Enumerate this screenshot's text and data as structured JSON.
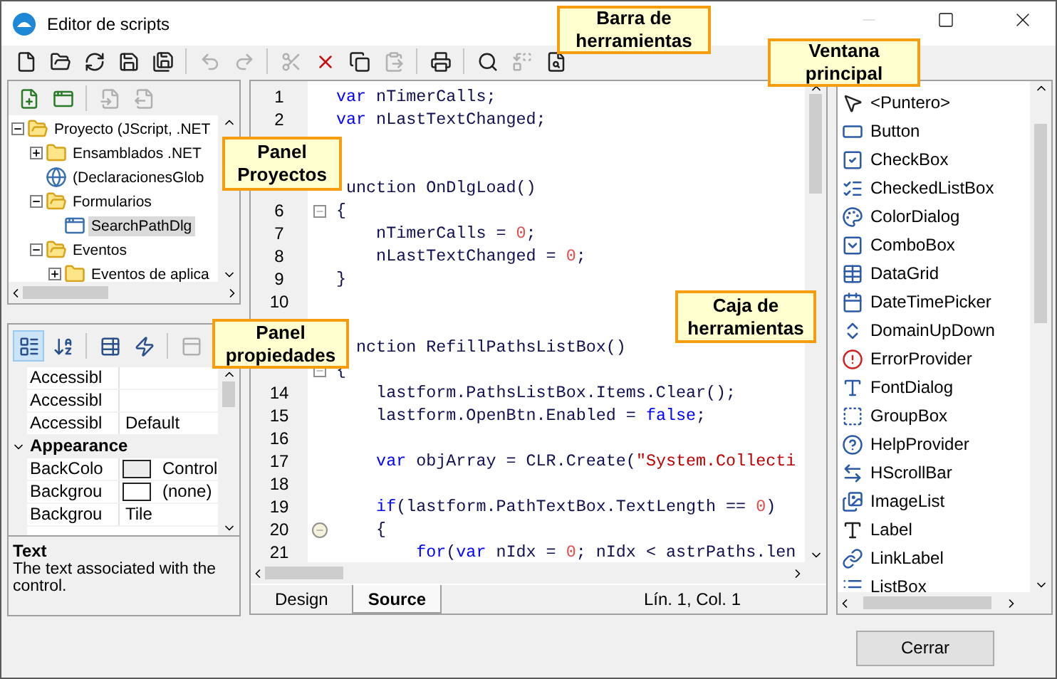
{
  "window": {
    "title": "Editor de scripts",
    "minimize_disabled": true
  },
  "main_toolbar": [
    {
      "disabled": false
    },
    {
      "disabled": false
    },
    {
      "disabled": false
    },
    {
      "disabled": false
    },
    {
      "disabled": false
    },
    {
      "disabled": true
    },
    {
      "disabled": true
    },
    {
      "disabled": true
    },
    {
      "disabled": false
    },
    {
      "disabled": false
    },
    {
      "disabled": true
    },
    {
      "disabled": false
    },
    {
      "disabled": false
    },
    {
      "disabled": true
    },
    {
      "disabled": false
    }
  ],
  "project_toolbar": [
    {
      "disabled": false
    },
    {
      "disabled": false
    },
    {
      "disabled": true
    },
    {
      "disabled": true
    }
  ],
  "tree": [
    {
      "kind": "folder",
      "label": "Proyecto (JScript, .NET",
      "expanded": true,
      "selected": false,
      "children": [
        {
          "kind": "folder",
          "label": "Ensamblados .NET",
          "expanded": false,
          "selected": false
        },
        {
          "kind": "globals",
          "label": "(DeclaracionesGlob",
          "selected": false
        },
        {
          "kind": "folder",
          "label": "Formularios",
          "expanded": true,
          "selected": false,
          "children": [
            {
              "kind": "form",
              "label": "SearchPathDlg",
              "selected": true
            }
          ]
        },
        {
          "kind": "folder",
          "label": "Eventos",
          "expanded": true,
          "selected": false,
          "children": [
            {
              "kind": "folder",
              "label": "Eventos de aplica",
              "expanded": false,
              "selected": false
            }
          ]
        }
      ]
    }
  ],
  "properties_toolbar": [
    {
      "selected": true,
      "disabled": false
    },
    {
      "selected": false,
      "disabled": false
    },
    {
      "selected": false,
      "disabled": false
    },
    {
      "selected": false,
      "disabled": false
    },
    {
      "selected": false,
      "disabled": true
    }
  ],
  "properties": [
    {
      "kind": "property",
      "name": "Accessibl"
    },
    {
      "kind": "property",
      "name": "Accessibl"
    },
    {
      "kind": "property",
      "name": "Accessibl",
      "value": "Default"
    },
    {
      "kind": "category",
      "name": "Appearance",
      "expanded": true
    },
    {
      "kind": "property",
      "name": "BackColo",
      "color": "#ececec",
      "value": "Control"
    },
    {
      "kind": "property",
      "name": "Backgrou",
      "color": "#ffffff",
      "value": "(none)"
    },
    {
      "kind": "property",
      "name": "Backgrou",
      "value": "Tile"
    }
  ],
  "description": {
    "title": "Text",
    "text": "The text associated with the control."
  },
  "code": [
    {
      "kind": "line",
      "number": "1",
      "tokens": [
        {
          "kind": "keyword",
          "text": "var"
        },
        {
          "kind": "plain",
          "text": " nTimerCalls;"
        }
      ]
    },
    {
      "kind": "line",
      "number": "2",
      "tokens": [
        {
          "kind": "keyword",
          "text": "var"
        },
        {
          "kind": "plain",
          "text": " nLastTextChanged;"
        }
      ]
    },
    {
      "kind": "covered"
    },
    {
      "kind": "covered"
    },
    {
      "kind": "line",
      "tokens": [
        {
          "kind": "plain",
          "text": " unction OnDlgLoad()"
        }
      ]
    },
    {
      "kind": "line",
      "number": "6",
      "fold_open": true,
      "tokens": [
        {
          "kind": "plain",
          "text": "{"
        }
      ]
    },
    {
      "kind": "line",
      "number": "7",
      "tokens": [
        {
          "kind": "plain",
          "text": "    nTimerCalls = "
        },
        {
          "kind": "number",
          "text": "0"
        },
        {
          "kind": "plain",
          "text": ";"
        }
      ]
    },
    {
      "kind": "line",
      "number": "8",
      "tokens": [
        {
          "kind": "plain",
          "text": "    nLastTextChanged = "
        },
        {
          "kind": "number",
          "text": "0"
        },
        {
          "kind": "plain",
          "text": ";"
        }
      ]
    },
    {
      "kind": "line",
      "number": "9",
      "tokens": [
        {
          "kind": "plain",
          "text": "}"
        }
      ]
    },
    {
      "kind": "line",
      "number": "10"
    },
    {
      "kind": "covered"
    },
    {
      "kind": "line",
      "tokens": [
        {
          "kind": "plain",
          "text": "  nction RefillPathsListBox()"
        }
      ]
    },
    {
      "kind": "line",
      "fold_open": true,
      "tokens": [
        {
          "kind": "plain",
          "text": "{"
        }
      ]
    },
    {
      "kind": "line",
      "number": "14",
      "tokens": [
        {
          "kind": "plain",
          "text": "    lastform.PathsListBox.Items.Clear();"
        }
      ]
    },
    {
      "kind": "line",
      "number": "15",
      "tokens": [
        {
          "kind": "plain",
          "text": "    lastform.OpenBtn.Enabled = "
        },
        {
          "kind": "keyword",
          "text": "false"
        },
        {
          "kind": "plain",
          "text": ";"
        }
      ]
    },
    {
      "kind": "line",
      "number": "16"
    },
    {
      "kind": "line",
      "number": "17",
      "tokens": [
        {
          "kind": "keyword",
          "text": "    var"
        },
        {
          "kind": "plain",
          "text": " objArray = CLR.Create("
        },
        {
          "kind": "string",
          "text": "\"System.Collecti"
        }
      ]
    },
    {
      "kind": "line",
      "number": "18"
    },
    {
      "kind": "line",
      "number": "19",
      "tokens": [
        {
          "kind": "keyword",
          "text": "    if"
        },
        {
          "kind": "plain",
          "text": "(lastform.PathTextBox.TextLength == "
        },
        {
          "kind": "number",
          "text": "0"
        },
        {
          "kind": "plain",
          "text": ")"
        }
      ]
    },
    {
      "kind": "line",
      "number": "20",
      "fold_point": true,
      "tokens": [
        {
          "kind": "plain",
          "text": "    {"
        }
      ]
    },
    {
      "kind": "line",
      "number": "21",
      "tokens": [
        {
          "kind": "keyword",
          "text": "        for"
        },
        {
          "kind": "plain",
          "text": "("
        },
        {
          "kind": "keyword",
          "text": "var"
        },
        {
          "kind": "plain",
          "text": " nIdx = "
        },
        {
          "kind": "number",
          "text": "0"
        },
        {
          "kind": "plain",
          "text": "; nIdx < astrPaths.len"
        }
      ]
    }
  ],
  "editor_tabs": [
    {
      "label": "Design",
      "selected": false
    },
    {
      "label": "Source",
      "selected": true
    }
  ],
  "status": "Lín. 1, Col. 1",
  "toolbox": [
    "<Puntero>",
    "Button",
    "CheckBox",
    "CheckedListBox",
    "ColorDialog",
    "ComboBox",
    "DataGrid",
    "DateTimePicker",
    "DomainUpDown",
    "ErrorProvider",
    "FontDialog",
    "GroupBox",
    "HelpProvider",
    "HScrollBar",
    "ImageList",
    "Label",
    "LinkLabel",
    "ListBox"
  ],
  "close_button": "Cerrar",
  "callouts": [
    "Barra de herramientas",
    "Ventana principal",
    "Panel Proyectos",
    "Panel propiedades",
    "Caja de herramientas"
  ]
}
